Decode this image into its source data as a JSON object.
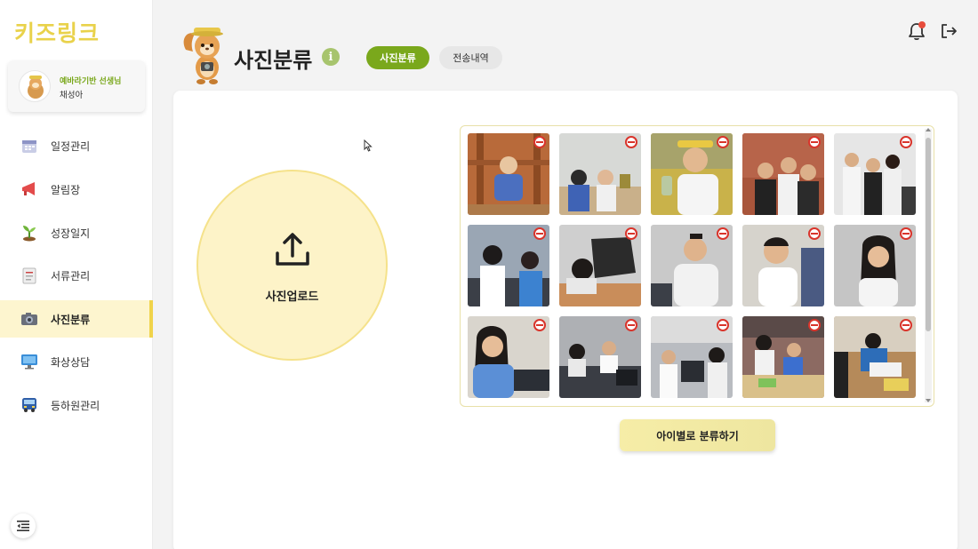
{
  "sidebar": {
    "logo": "키즈링크",
    "profile": {
      "line1": "예바라기반 선생님",
      "line2": "채성아"
    },
    "items": [
      {
        "label": "일정관리",
        "icon": "calendar-icon"
      },
      {
        "label": "알림장",
        "icon": "megaphone-icon"
      },
      {
        "label": "성장일지",
        "icon": "sprout-icon"
      },
      {
        "label": "서류관리",
        "icon": "document-icon"
      },
      {
        "label": "사진분류",
        "icon": "camera-icon",
        "active": true
      },
      {
        "label": "화상상담",
        "icon": "monitor-icon"
      },
      {
        "label": "등하원관리",
        "icon": "bus-icon"
      }
    ]
  },
  "header": {
    "title": "사진분류",
    "tabs": [
      {
        "label": "사진분류",
        "active": true
      },
      {
        "label": "전송내역",
        "active": false
      }
    ]
  },
  "upload": {
    "label": "사진업로드"
  },
  "photos": [
    "photo-1",
    "photo-2",
    "photo-3",
    "photo-4",
    "photo-5",
    "photo-6",
    "photo-7",
    "photo-8",
    "photo-9",
    "photo-10",
    "photo-11",
    "photo-12",
    "photo-13",
    "photo-14",
    "photo-15"
  ],
  "actions": {
    "classify_label": "아이별로 분류하기"
  },
  "colors": {
    "accent": "#7aa81c",
    "highlight": "#fdf5cf",
    "logo": "#e9d24b",
    "remove": "#d9342b"
  }
}
